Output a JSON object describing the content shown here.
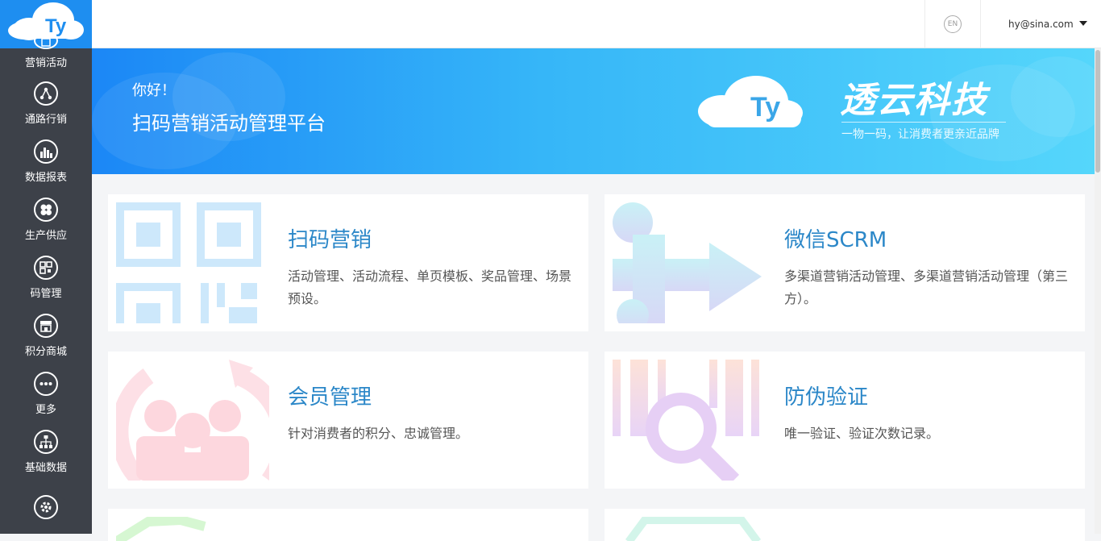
{
  "sidebar": {
    "logo_text": "Ty",
    "items": [
      {
        "label": "营销活动",
        "icon": "shopping-bag-icon"
      },
      {
        "label": "通路行销",
        "icon": "network-icon"
      },
      {
        "label": "数据报表",
        "icon": "bar-chart-icon"
      },
      {
        "label": "生产供应",
        "icon": "supply-icon"
      },
      {
        "label": "码管理",
        "icon": "qrcode-icon"
      },
      {
        "label": "积分商城",
        "icon": "store-icon"
      },
      {
        "label": "更多",
        "icon": "more-dots-icon"
      },
      {
        "label": "基础数据",
        "icon": "org-chart-icon"
      },
      {
        "label": "",
        "icon": "gear-icon"
      }
    ]
  },
  "header": {
    "lang_label": "EN",
    "user_email": "hy@sina.com"
  },
  "banner": {
    "greeting": "你好！",
    "subtitle": "扫码营销活动管理平台",
    "logo_text": "Ty",
    "brand_name": "透云科技",
    "brand_slogan": "一物一码，让消费者更亲近品牌"
  },
  "cards": [
    {
      "title": "扫码营销",
      "desc": "活动管理、活动流程、单页模板、奖品管理、场景预设。",
      "icon": "qrcode-icon"
    },
    {
      "title": "微信SCRM",
      "desc": "多渠道营销活动管理、多渠道营销活动管理（第三方）。",
      "icon": "arrow-flow-icon"
    },
    {
      "title": "会员管理",
      "desc": "针对消费者的积分、忠诚管理。",
      "icon": "members-icon"
    },
    {
      "title": "防伪验证",
      "desc": "唯一验证、验证次数记录。",
      "icon": "barcode-search-icon"
    }
  ],
  "colors": {
    "sidebar": "#3d4149",
    "accent": "#1e8ef0",
    "card_title": "#2b87c8"
  }
}
